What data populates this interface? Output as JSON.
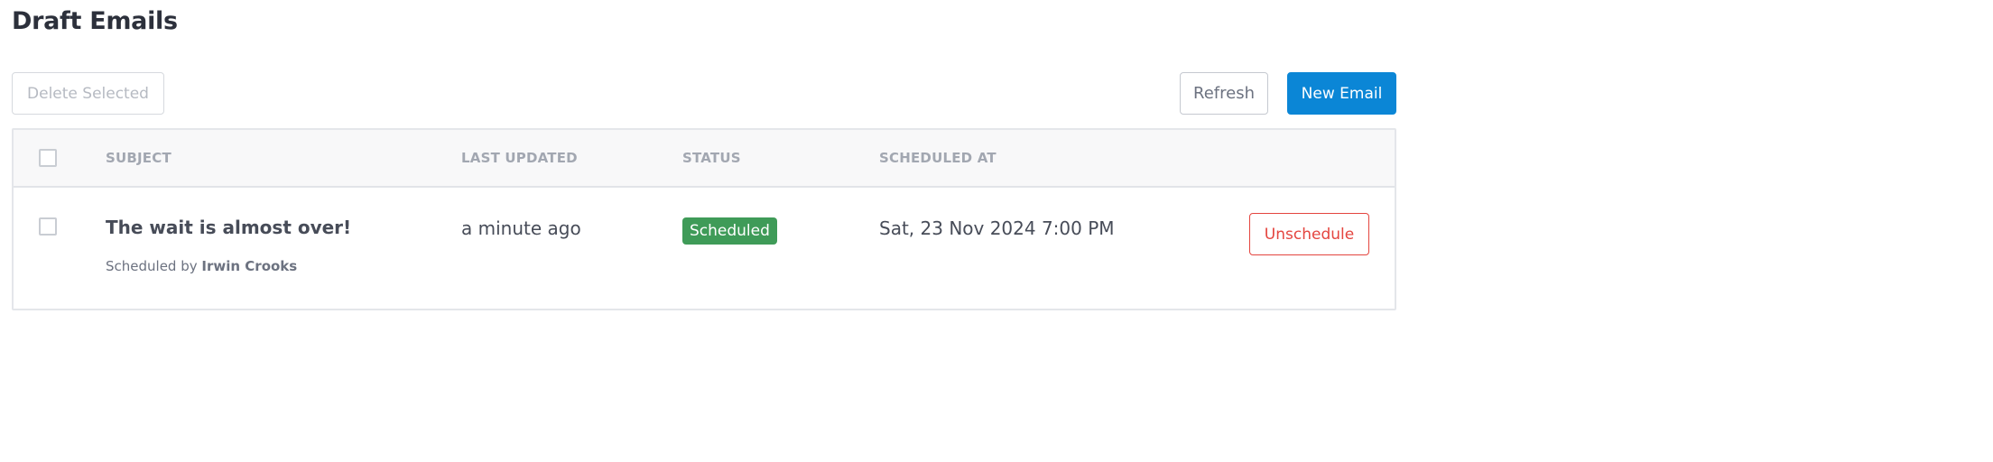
{
  "page": {
    "title": "Draft Emails"
  },
  "toolbar": {
    "delete_label": "Delete Selected",
    "refresh_label": "Refresh",
    "new_label": "New Email"
  },
  "table": {
    "columns": {
      "subject": "SUBJECT",
      "last_updated": "LAST UPDATED",
      "status": "STATUS",
      "scheduled_at": "SCHEDULED AT"
    },
    "rows": [
      {
        "subject": "The wait is almost over!",
        "byline_prefix": "Scheduled by",
        "byline_name": "Irwin Crooks",
        "last_updated": "a minute ago",
        "status": "Scheduled",
        "scheduled_at": "Sat, 23 Nov 2024 7:00 PM",
        "action_label": "Unschedule",
        "selected": false
      }
    ]
  },
  "colors": {
    "primary": "#0b86d6",
    "status_scheduled": "#3f9b58",
    "danger": "#e4453f"
  }
}
